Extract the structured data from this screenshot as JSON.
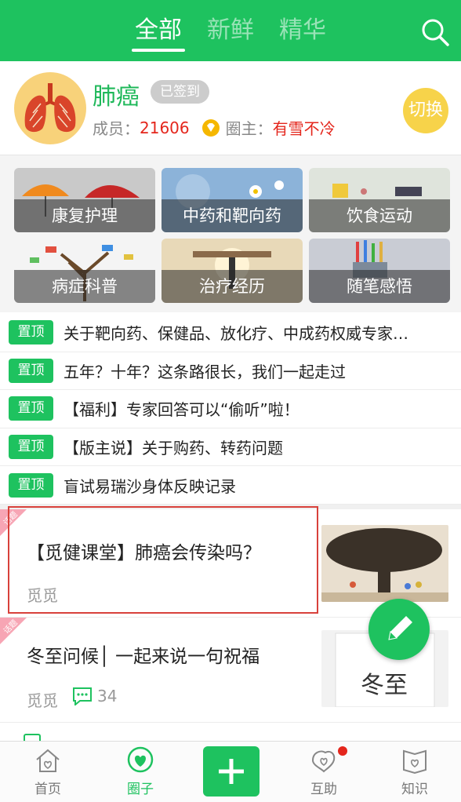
{
  "header": {
    "tabs": [
      {
        "label": "全部",
        "active": true
      },
      {
        "label": "新鲜",
        "active": false
      },
      {
        "label": "精华",
        "active": false
      }
    ],
    "search_icon": "search-icon",
    "brand_color": "#1ec25f"
  },
  "group": {
    "name": "肺癌",
    "signed_label": "已签到",
    "members_label": "成员：",
    "members_count": "21606",
    "owner_label": "圈主：",
    "owner_name": "有雪不冷",
    "switch_label": "切换"
  },
  "categories": [
    {
      "label": "康复护理"
    },
    {
      "label": "中药和靶向药"
    },
    {
      "label": "饮食运动"
    },
    {
      "label": "病症科普"
    },
    {
      "label": "治疗经历"
    },
    {
      "label": "随笔感悟"
    }
  ],
  "pinned": {
    "badge": "置顶",
    "items": [
      "关于靶向药、保健品、放化疗、中成药权威专家…",
      "五年？十年？这条路很长，我们一起走过",
      "【福利】专家回答可以“偷听”啦！",
      "【版主说】关于购药、转药问题",
      "盲试易瑞沙身体反映记录"
    ]
  },
  "posts": [
    {
      "ribbon": "话题",
      "title": "【觅健课堂】肺癌会传染吗？",
      "author": "觅觅"
    },
    {
      "ribbon": "话题",
      "title": "冬至问候│ 一起来说一句祝福",
      "author": "觅觅",
      "comments": "34",
      "thumb_text": "冬至"
    }
  ],
  "bottom_nav": {
    "items": [
      {
        "label": "首页",
        "icon": "home-icon",
        "active": false
      },
      {
        "label": "圈子",
        "icon": "circle-heart-icon",
        "active": true
      },
      {
        "label": "互助",
        "icon": "help-heart-icon",
        "active": false
      },
      {
        "label": "知识",
        "icon": "knowledge-icon",
        "active": false
      }
    ],
    "plus_icon": "plus-icon"
  }
}
